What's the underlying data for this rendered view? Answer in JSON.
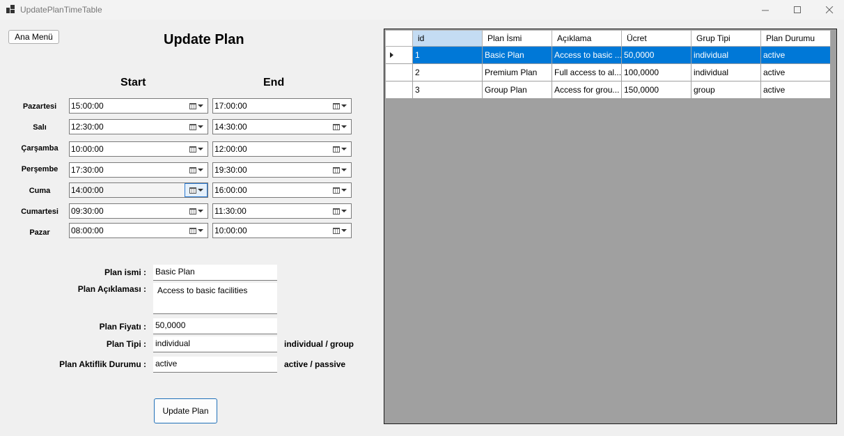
{
  "window": {
    "title": "UpdatePlanTimeTable"
  },
  "left": {
    "menu_button": "Ana Menü",
    "title": "Update Plan",
    "start_header": "Start",
    "end_header": "End",
    "days": [
      {
        "label": "Pazartesi",
        "start": "15:00:00",
        "end": "17:00:00"
      },
      {
        "label": "Salı",
        "start": "12:30:00",
        "end": "14:30:00"
      },
      {
        "label": "Çarşamba",
        "start": "10:00:00",
        "end": "12:00:00"
      },
      {
        "label": "Perşembe",
        "start": "17:30:00",
        "end": "19:30:00"
      },
      {
        "label": "Cuma",
        "start": "14:00:00",
        "end": "16:00:00"
      },
      {
        "label": "Cumartesi",
        "start": "09:30:00",
        "end": "11:30:00"
      },
      {
        "label": "Pazar",
        "start": "08:00:00",
        "end": "10:00:00"
      }
    ],
    "form": {
      "name_label": "Plan ismi :",
      "name_value": "Basic Plan",
      "desc_label": "Plan Açıklaması :",
      "desc_value": "Access to basic facilities",
      "price_label": "Plan Fiyatı :",
      "price_value": "50,0000",
      "type_label": "Plan Tipi :",
      "type_value": "individual",
      "type_hint": "individual / group",
      "status_label": "Plan Aktiflik Durumu :",
      "status_value": "active",
      "status_hint": "active / passive"
    },
    "update_button": "Update Plan"
  },
  "grid": {
    "columns": [
      "id",
      "Plan İsmi",
      "Açıklama",
      "Ücret",
      "Grup Tipi",
      "Plan Durumu"
    ],
    "rows": [
      [
        "1",
        "Basic Plan",
        "Access to basic ...",
        "50,0000",
        "individual",
        "active"
      ],
      [
        "2",
        "Premium Plan",
        "Full access to al...",
        "100,0000",
        "individual",
        "active"
      ],
      [
        "3",
        "Group Plan",
        "Access for grou...",
        "150,0000",
        "group",
        "active"
      ]
    ],
    "selected_color": "#0078d7"
  }
}
